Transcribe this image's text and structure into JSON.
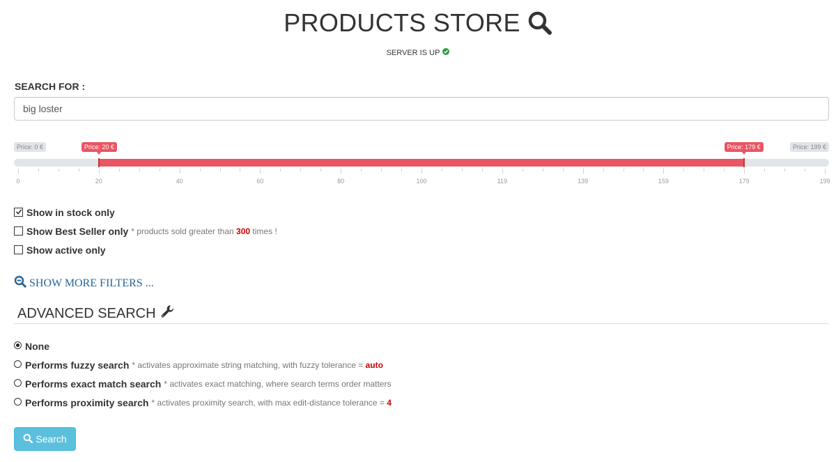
{
  "header": {
    "title": "PRODUCTS STORE",
    "title_icon": "search-icon",
    "server_status": "SERVER IS UP",
    "server_status_icon": "check-circle-icon",
    "server_status_color": "#2ea043"
  },
  "search": {
    "label": "SEARCH FOR :",
    "value": "big loster"
  },
  "price_slider": {
    "min_label": "Price: 0 €",
    "max_label": "Price: 199 €",
    "from_label": "Price: 20 €",
    "to_label": "Price: 179 €",
    "min": 0,
    "max": 199,
    "from": 20,
    "to": 179,
    "tick_labels": [
      "0",
      "20",
      "40",
      "60",
      "80",
      "100",
      "119",
      "139",
      "159",
      "179",
      "199"
    ],
    "accent_color": "#e85563"
  },
  "filters": {
    "in_stock": {
      "label": "Show in stock only",
      "checked": true
    },
    "best_seller": {
      "label": "Show Best Seller only",
      "checked": false,
      "note_prefix": "* products sold greater than",
      "note_value": "300",
      "note_suffix": "times !"
    },
    "active": {
      "label": "Show active only",
      "checked": false
    }
  },
  "more_filters": {
    "label": "SHOW MORE FILTERS ...",
    "icon": "zoom-out-icon"
  },
  "advanced": {
    "title": "ADVANCED SEARCH",
    "icon": "wrench-icon",
    "options": {
      "none": {
        "label": "None",
        "selected": true
      },
      "fuzzy": {
        "label": "Performs fuzzy search",
        "note": "* activates approximate string matching, with fuzzy tolerance =",
        "value": "auto",
        "selected": false
      },
      "exact": {
        "label": "Performs exact match search",
        "note": "* activates exact matching, where search terms order matters",
        "selected": false
      },
      "proximity": {
        "label": "Performs proximity search",
        "note": "* activates proximity search, with max edit-distance tolerance =",
        "value": "4",
        "selected": false
      }
    }
  },
  "search_button": {
    "label": "Search",
    "icon": "search-icon",
    "color": "#5bc0de"
  }
}
